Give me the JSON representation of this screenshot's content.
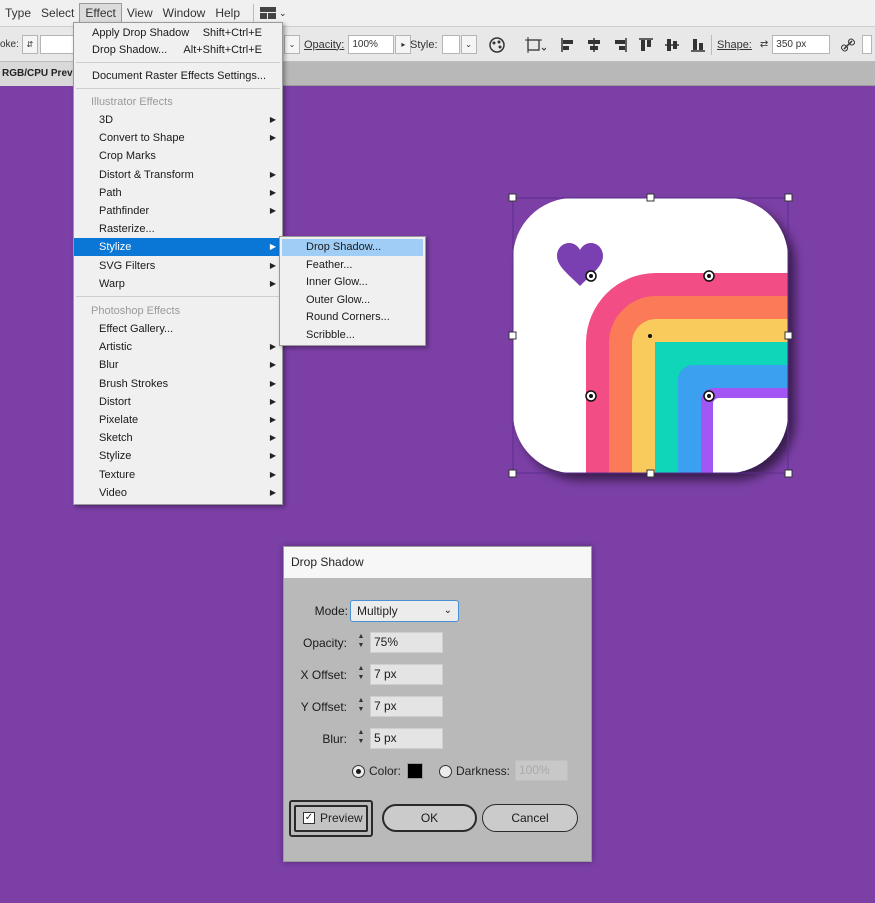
{
  "menubar": {
    "items": [
      "Type",
      "Select",
      "Effect",
      "View",
      "Window",
      "Help"
    ],
    "active": "Effect"
  },
  "controlbar": {
    "stroke_label": "oke:",
    "opacity_label": "Opacity:",
    "opacity_value": "100%",
    "style_label": "Style:",
    "shape_label": "Shape:",
    "shape_value": "350 px"
  },
  "document_tab": {
    "label": "RGB/CPU Previ"
  },
  "effect_menu": {
    "apply_label": "Apply Drop Shadow",
    "apply_shortcut": "Shift+Ctrl+E",
    "drop_label": "Drop Shadow...",
    "drop_shortcut": "Alt+Shift+Ctrl+E",
    "raster_settings": "Document Raster Effects Settings...",
    "illustrator_header": "Illustrator Effects",
    "illustrator_items": [
      "3D",
      "Convert to Shape",
      "Crop Marks",
      "Distort & Transform",
      "Path",
      "Pathfinder",
      "Rasterize...",
      "Stylize",
      "SVG Filters",
      "Warp"
    ],
    "photoshop_header": "Photoshop Effects",
    "photoshop_items": [
      "Effect Gallery...",
      "Artistic",
      "Blur",
      "Brush Strokes",
      "Distort",
      "Pixelate",
      "Sketch",
      "Stylize",
      "Texture",
      "Video"
    ],
    "highlighted": "Stylize"
  },
  "stylize_submenu": {
    "items": [
      "Drop Shadow...",
      "Feather...",
      "Inner Glow...",
      "Outer Glow...",
      "Round Corners...",
      "Scribble..."
    ],
    "highlighted": "Drop Shadow..."
  },
  "dialog": {
    "title": "Drop Shadow",
    "mode_label": "Mode:",
    "mode_value": "Multiply",
    "opacity_label": "Opacity:",
    "opacity_value": "75%",
    "x_offset_label": "X Offset:",
    "x_offset_value": "7 px",
    "y_offset_label": "Y Offset:",
    "y_offset_value": "7 px",
    "blur_label": "Blur:",
    "blur_value": "5 px",
    "color_label": "Color:",
    "darkness_label": "Darkness:",
    "darkness_value": "100%",
    "preview_label": "Preview",
    "ok_label": "OK",
    "cancel_label": "Cancel"
  },
  "colors": {
    "canvas_background": "#7b3fa6",
    "menu_highlight": "#0a76d6",
    "submenu_highlight": "#9fcdf5",
    "heart": "#7a3fb0",
    "rainbow": [
      "#f24d84",
      "#fb7b59",
      "#f8cb5c",
      "#0fd6b9",
      "#3aa0ef",
      "#a257f5"
    ]
  }
}
